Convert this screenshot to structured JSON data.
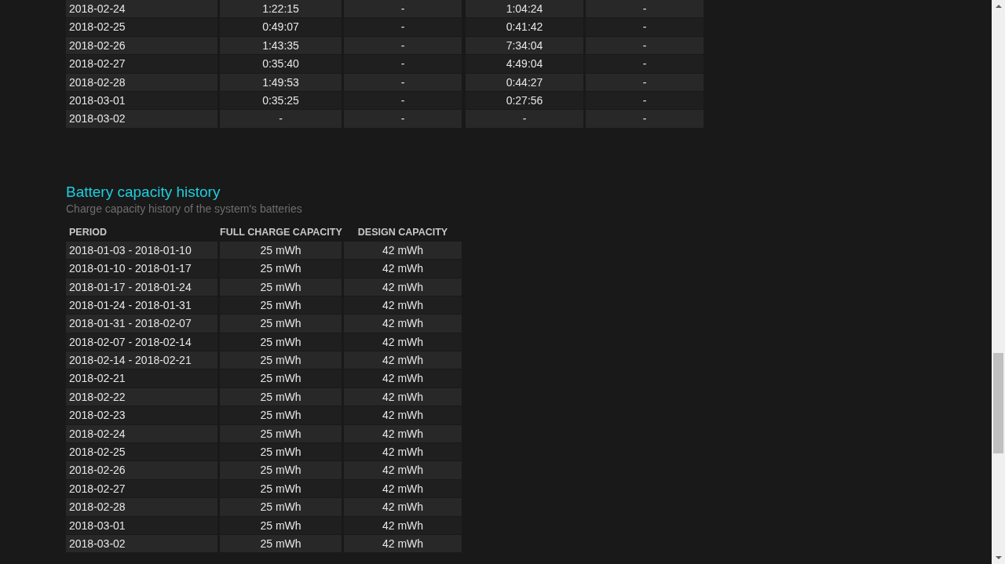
{
  "usage_table": {
    "rows": [
      [
        "2018-02-24",
        "1:22:15",
        "-",
        "1:04:24",
        "-"
      ],
      [
        "2018-02-25",
        "0:49:07",
        "-",
        "0:41:42",
        "-"
      ],
      [
        "2018-02-26",
        "1:43:35",
        "-",
        "7:34:04",
        "-"
      ],
      [
        "2018-02-27",
        "0:35:40",
        "-",
        "4:49:04",
        "-"
      ],
      [
        "2018-02-28",
        "1:49:53",
        "-",
        "0:44:27",
        "-"
      ],
      [
        "2018-03-01",
        "0:35:25",
        "-",
        "0:27:56",
        "-"
      ],
      [
        "2018-03-02",
        "-",
        "-",
        "-",
        "-"
      ]
    ]
  },
  "capacity_history": {
    "title": "Battery capacity history",
    "subtitle": "Charge capacity history of the system's batteries",
    "columns": [
      "PERIOD",
      "FULL CHARGE CAPACITY",
      "DESIGN CAPACITY"
    ],
    "rows": [
      [
        "2018-01-03 - 2018-01-10",
        "25 mWh",
        "42 mWh"
      ],
      [
        "2018-01-10 - 2018-01-17",
        "25 mWh",
        "42 mWh"
      ],
      [
        "2018-01-17 - 2018-01-24",
        "25 mWh",
        "42 mWh"
      ],
      [
        "2018-01-24 - 2018-01-31",
        "25 mWh",
        "42 mWh"
      ],
      [
        "2018-01-31 - 2018-02-07",
        "25 mWh",
        "42 mWh"
      ],
      [
        "2018-02-07 - 2018-02-14",
        "25 mWh",
        "42 mWh"
      ],
      [
        "2018-02-14 - 2018-02-21",
        "25 mWh",
        "42 mWh"
      ],
      [
        "2018-02-21",
        "25 mWh",
        "42 mWh"
      ],
      [
        "2018-02-22",
        "25 mWh",
        "42 mWh"
      ],
      [
        "2018-02-23",
        "25 mWh",
        "42 mWh"
      ],
      [
        "2018-02-24",
        "25 mWh",
        "42 mWh"
      ],
      [
        "2018-02-25",
        "25 mWh",
        "42 mWh"
      ],
      [
        "2018-02-26",
        "25 mWh",
        "42 mWh"
      ],
      [
        "2018-02-27",
        "25 mWh",
        "42 mWh"
      ],
      [
        "2018-02-28",
        "25 mWh",
        "42 mWh"
      ],
      [
        "2018-03-01",
        "25 mWh",
        "42 mWh"
      ],
      [
        "2018-03-02",
        "25 mWh",
        "42 mWh"
      ]
    ]
  }
}
